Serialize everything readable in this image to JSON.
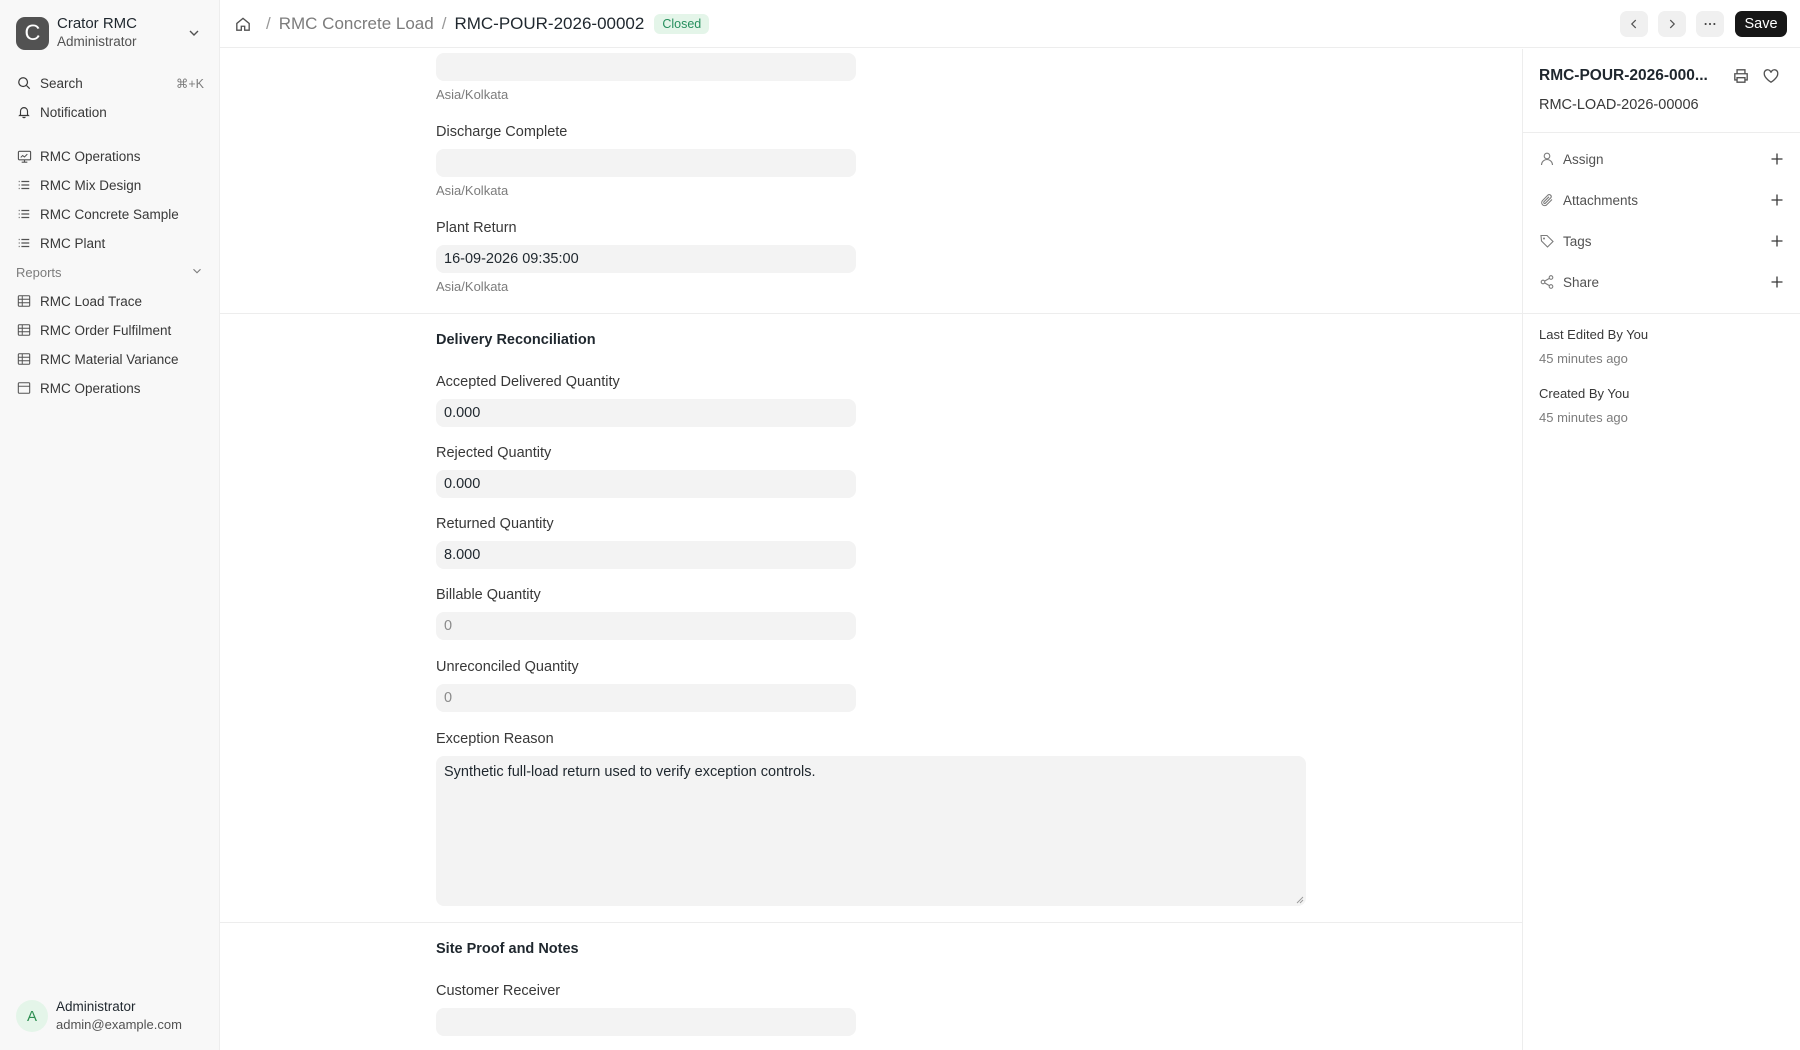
{
  "workspace": {
    "name": "Crator RMC",
    "role": "Administrator",
    "logo_letter": "C"
  },
  "sidebar": {
    "search_label": "Search",
    "search_shortcut": "⌘+K",
    "notification_label": "Notification",
    "items": [
      {
        "label": "RMC Operations",
        "icon": "monitor-icon"
      },
      {
        "label": "RMC Mix Design",
        "icon": "list-icon"
      },
      {
        "label": "RMC Concrete Sample",
        "icon": "list-icon"
      },
      {
        "label": "RMC Plant",
        "icon": "list-icon"
      }
    ],
    "reports_label": "Reports",
    "reports": [
      {
        "label": "RMC Load Trace",
        "icon": "table-icon"
      },
      {
        "label": "RMC Order Fulfilment",
        "icon": "table-icon"
      },
      {
        "label": "RMC Material Variance",
        "icon": "table-icon"
      },
      {
        "label": "RMC Operations",
        "icon": "dashboard-icon"
      }
    ]
  },
  "user": {
    "initial": "A",
    "name": "Administrator",
    "email": "admin@example.com"
  },
  "header": {
    "breadcrumb_parent": "RMC Concrete Load",
    "breadcrumb_current": "RMC-POUR-2026-00002",
    "status": "Closed",
    "save_label": "Save"
  },
  "form": {
    "timezone": "Asia/Kolkata",
    "top_field_value": "",
    "discharge_complete": {
      "label": "Discharge Complete",
      "value": ""
    },
    "plant_return": {
      "label": "Plant Return",
      "value": "16-09-2026 09:35:00"
    },
    "delivery_reconciliation": {
      "title": "Delivery Reconciliation",
      "accepted": {
        "label": "Accepted Delivered Quantity",
        "value": "0.000"
      },
      "rejected": {
        "label": "Rejected Quantity",
        "value": "0.000"
      },
      "returned": {
        "label": "Returned Quantity",
        "value": "8.000"
      },
      "billable": {
        "label": "Billable Quantity",
        "value": "0"
      },
      "unreconciled": {
        "label": "Unreconciled Quantity",
        "value": "0"
      },
      "exception_reason": {
        "label": "Exception Reason",
        "value": "Synthetic full-load return used to verify exception controls."
      }
    },
    "site_proof": {
      "title": "Site Proof and Notes",
      "customer_receiver": {
        "label": "Customer Receiver",
        "value": ""
      }
    }
  },
  "right_panel": {
    "title": "RMC-POUR-2026-000...",
    "subtitle": "RMC-LOAD-2026-00006",
    "assign_label": "Assign",
    "attachments_label": "Attachments",
    "tags_label": "Tags",
    "share_label": "Share",
    "last_edited_label": "Last Edited By You",
    "last_edited_time": "45 minutes ago",
    "created_label": "Created By You",
    "created_time": "45 minutes ago"
  },
  "colors": {
    "accent": "#171717",
    "status_bg": "#e4f5e9",
    "status_fg": "#278f5e"
  }
}
